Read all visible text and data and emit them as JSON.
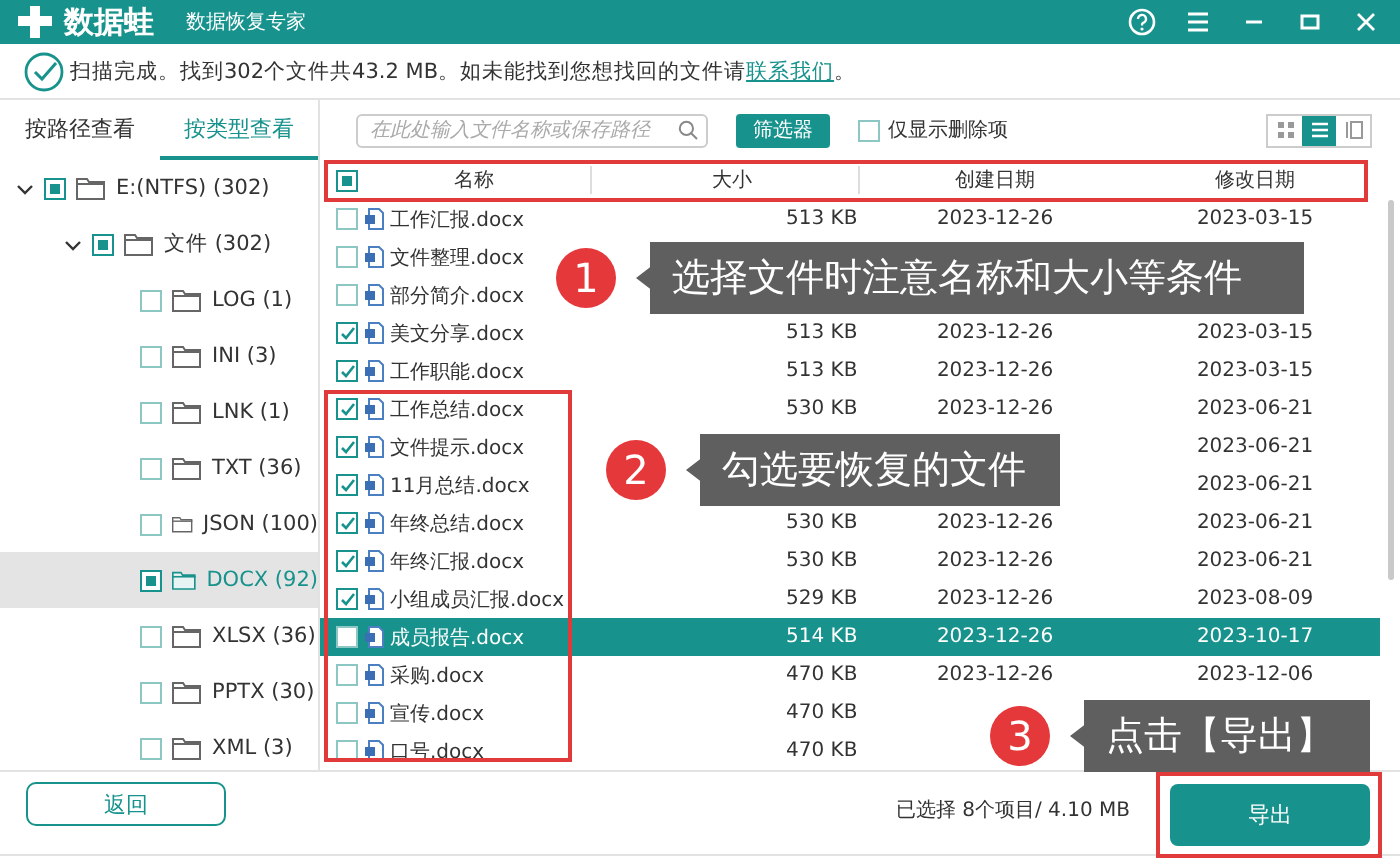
{
  "header": {
    "logo": "数据蛙",
    "subtitle": "数据恢复专家"
  },
  "status": {
    "prefix": "扫描完成。找到302个文件共43.2 MB。如未能找到您想找回的文件请",
    "link": "联系我们",
    "suffix": "。"
  },
  "tabs": [
    {
      "label": "按路径查看",
      "selected": false
    },
    {
      "label": "按类型查看",
      "selected": true
    }
  ],
  "tree": [
    {
      "label": "E:(NTFS) (302)",
      "checked": true,
      "indeterminate": true,
      "selected": false,
      "expanded": true,
      "children": [
        {
          "label": "文件 (302)",
          "checked": true,
          "indeterminate": true,
          "selected": false,
          "expanded": true,
          "children": [
            {
              "label": "LOG (1)",
              "checked": false,
              "indeterminate": false,
              "selected": false
            },
            {
              "label": "INI (3)",
              "checked": false,
              "indeterminate": false,
              "selected": false
            },
            {
              "label": "LNK (1)",
              "checked": false,
              "indeterminate": false,
              "selected": false
            },
            {
              "label": "TXT (36)",
              "checked": false,
              "indeterminate": false,
              "selected": false
            },
            {
              "label": "JSON (100)",
              "checked": false,
              "indeterminate": false,
              "selected": false
            },
            {
              "label": "DOCX (92)",
              "checked": true,
              "indeterminate": true,
              "selected": true
            },
            {
              "label": "XLSX (36)",
              "checked": false,
              "indeterminate": false,
              "selected": false
            },
            {
              "label": "PPTX (30)",
              "checked": false,
              "indeterminate": false,
              "selected": false
            },
            {
              "label": "XML (3)",
              "checked": false,
              "indeterminate": false,
              "selected": false
            }
          ]
        }
      ]
    }
  ],
  "toolbar": {
    "search": {
      "placeholder": "在此处输入文件名称或保存路径"
    },
    "filter": "筛选器",
    "deleted_only": {
      "label": "仅显示删除项",
      "checked": false
    },
    "views": [
      {
        "kind": "grid",
        "selected": false
      },
      {
        "kind": "list",
        "selected": true
      },
      {
        "kind": "detail",
        "selected": false
      }
    ]
  },
  "table": {
    "select_all": {
      "checked": true,
      "indeterminate": true
    },
    "columns": [
      "名称",
      "大小",
      "创建日期",
      "修改日期"
    ],
    "rows": [
      {
        "name": "工作汇报.docx",
        "size": "513 KB",
        "created": "2023-12-26",
        "modified": "2023-03-15",
        "checked": false,
        "selected": false
      },
      {
        "name": "文件整理.docx",
        "checked": false,
        "selected": false
      },
      {
        "name": "部分简介.docx",
        "checked": false,
        "selected": false
      },
      {
        "name": "美文分享.docx",
        "size": "513 KB",
        "created": "2023-12-26",
        "modified": "2023-03-15",
        "checked": true,
        "selected": false
      },
      {
        "name": "工作职能.docx",
        "size": "513 KB",
        "created": "2023-12-26",
        "modified": "2023-03-15",
        "checked": true,
        "selected": false
      },
      {
        "name": "工作总结.docx",
        "size": "530 KB",
        "created": "2023-12-26",
        "modified": "2023-06-21",
        "checked": true,
        "selected": false
      },
      {
        "name": "文件提示.docx",
        "modified": "2023-06-21",
        "checked": true,
        "selected": false
      },
      {
        "name": "11月总结.docx",
        "modified": "2023-06-21",
        "checked": true,
        "selected": false
      },
      {
        "name": "年终总结.docx",
        "size": "530 KB",
        "created": "2023-12-26",
        "modified": "2023-06-21",
        "checked": true,
        "selected": false
      },
      {
        "name": "年终汇报.docx",
        "size": "530 KB",
        "created": "2023-12-26",
        "modified": "2023-06-21",
        "checked": true,
        "selected": false
      },
      {
        "name": "小组成员汇报.docx",
        "size": "529 KB",
        "created": "2023-12-26",
        "modified": "2023-08-09",
        "checked": true,
        "selected": false
      },
      {
        "name": "成员报告.docx",
        "size": "514 KB",
        "created": "2023-12-26",
        "modified": "2023-10-17",
        "checked": false,
        "selected": true
      },
      {
        "name": "采购.docx",
        "size": "470 KB",
        "created": "2023-12-26",
        "modified": "2023-12-06",
        "checked": false,
        "selected": false
      },
      {
        "name": "宣传.docx",
        "size": "470 KB",
        "checked": false,
        "selected": false
      },
      {
        "name": "口号.docx",
        "size": "470 KB",
        "checked": false,
        "selected": false
      }
    ]
  },
  "footer": {
    "back": "返回",
    "selection": "已选择 8个项目/ 4.10 MB",
    "export": "导出"
  },
  "annotations": [
    {
      "number": "1",
      "text": "选择文件时注意名称和大小等条件"
    },
    {
      "number": "2",
      "text": "勾选要恢复的文件"
    },
    {
      "number": "3",
      "text": "点击【导出】"
    }
  ]
}
